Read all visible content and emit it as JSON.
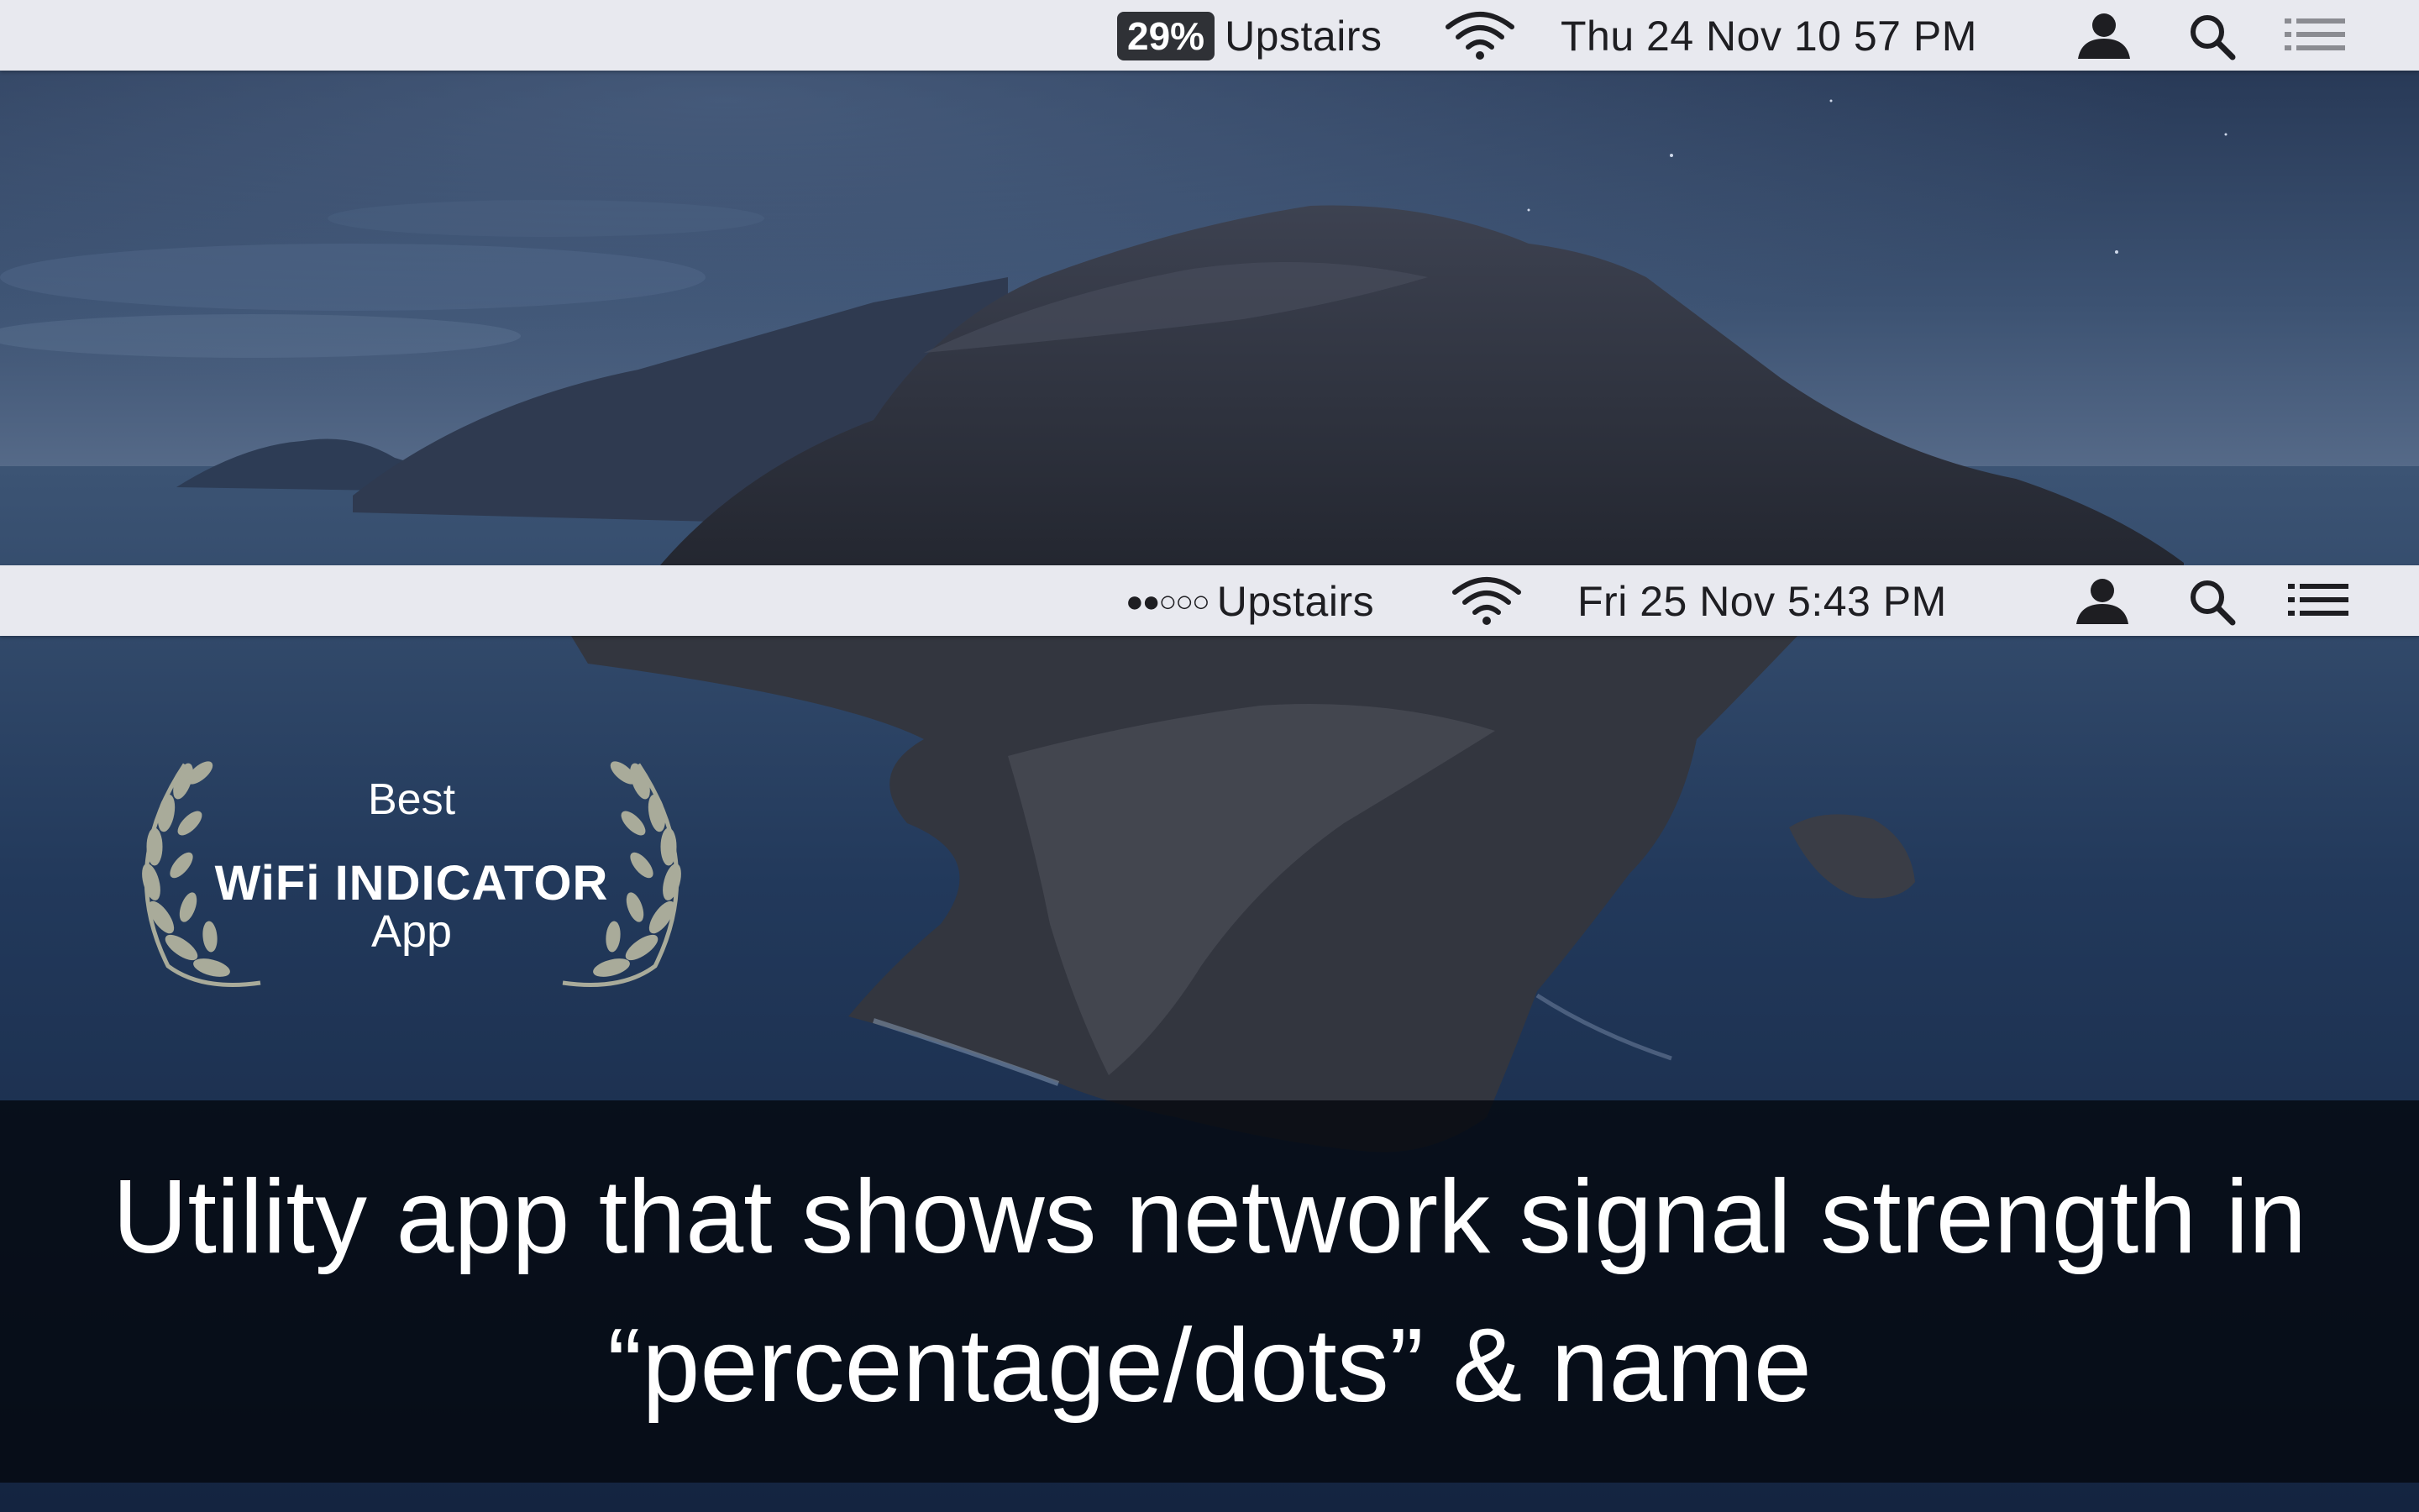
{
  "menubar_top": {
    "wifi_percentage": "29%",
    "network_name": "Upstairs",
    "datetime": "Thu 24 Nov  10 57 PM"
  },
  "menubar_bottom": {
    "signal_dots": "●●○○○",
    "network_name": "Upstairs",
    "datetime": "Fri 25 Nov  5:43 PM"
  },
  "award": {
    "line1": "Best",
    "line2": "WiFi INDICATOR",
    "line3": "App"
  },
  "caption": {
    "line1": "Utility app that shows network signal strength in",
    "line2": "“percentage/dots” & name"
  },
  "colors": {
    "menubar_bg": "#e8e9ef",
    "menubar_text": "#1e1e22",
    "badge_bg": "#2f3136",
    "laurel": "#a9ab9a",
    "caption_overlay": "#04080e"
  },
  "icons": [
    "wifi-icon",
    "user-icon",
    "search-icon",
    "notification-center-icon",
    "laurel-icon"
  ]
}
